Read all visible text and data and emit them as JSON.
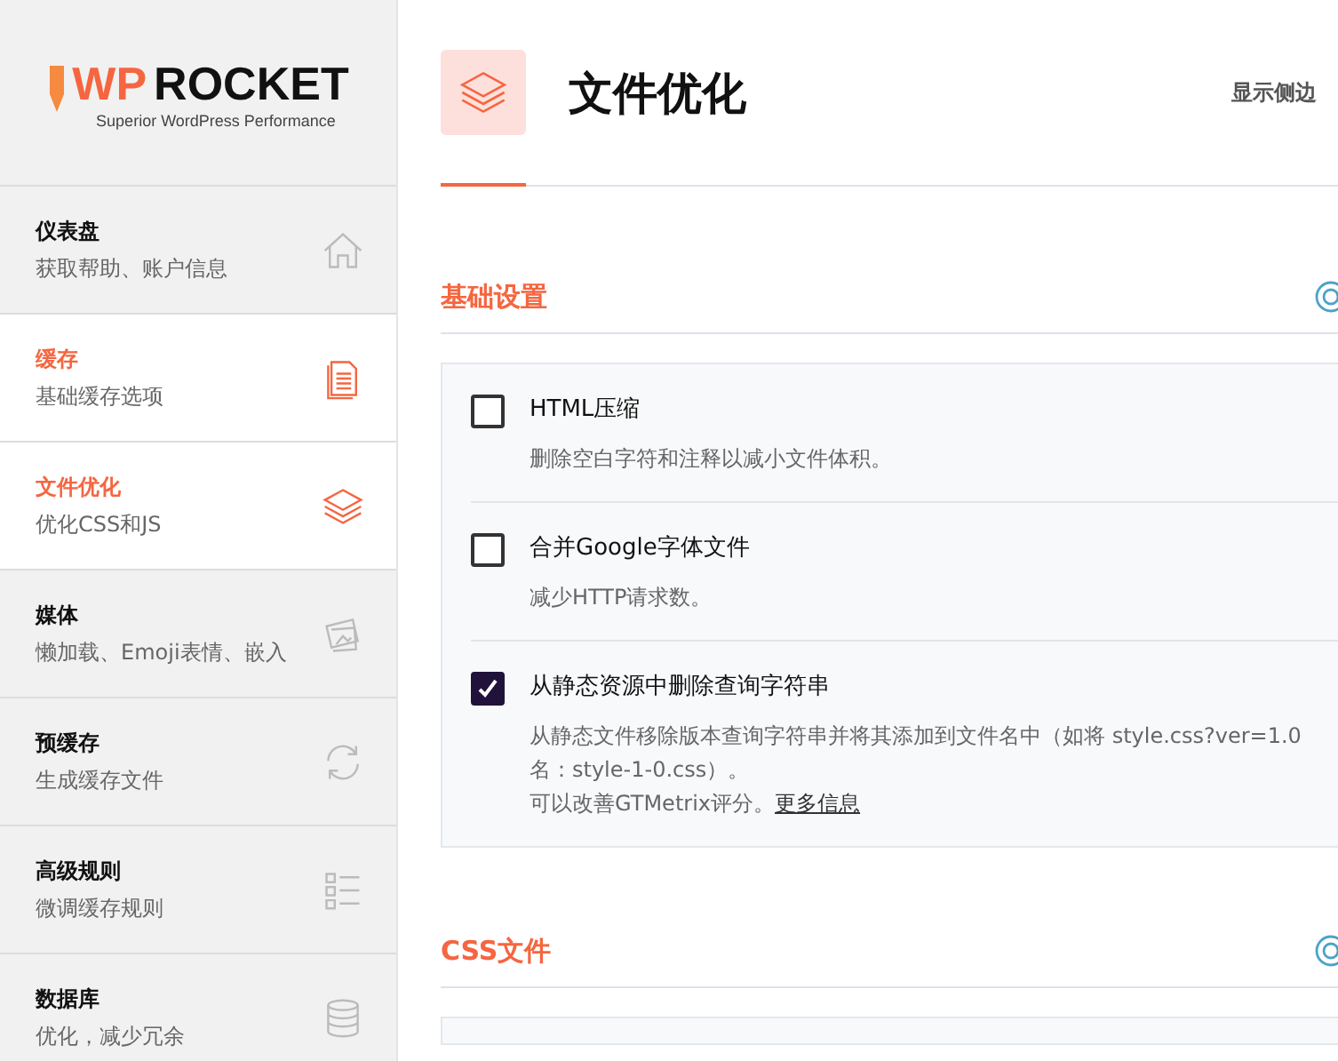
{
  "logo": {
    "name_wp": "WP",
    "name_rocket": "ROCKET",
    "tagline": "Superior WordPress Performance"
  },
  "sidebar": {
    "items": [
      {
        "title": "仪表盘",
        "subtitle": "获取帮助、账户信息",
        "highlighted": false
      },
      {
        "title": "缓存",
        "subtitle": "基础缓存选项",
        "highlighted": true
      },
      {
        "title": "文件优化",
        "subtitle": "优化CSS和JS",
        "highlighted": true
      },
      {
        "title": "媒体",
        "subtitle": "懒加载、Emoji表情、嵌入",
        "highlighted": false
      },
      {
        "title": "预缓存",
        "subtitle": "生成缓存文件",
        "highlighted": false
      },
      {
        "title": "高级规则",
        "subtitle": "微调缓存规则",
        "highlighted": false
      },
      {
        "title": "数据库",
        "subtitle": "优化，减少冗余",
        "highlighted": false
      }
    ]
  },
  "header": {
    "title": "文件优化",
    "sidebar_toggle": "显示侧边"
  },
  "sections": [
    {
      "title": "基础设置",
      "options": [
        {
          "label": "HTML压缩",
          "checked": false,
          "description": [
            "删除空白字符和注释以减小文件体积。"
          ]
        },
        {
          "label": "合并Google字体文件",
          "checked": false,
          "description": [
            "减少HTTP请求数。"
          ]
        },
        {
          "label": "从静态资源中删除查询字符串",
          "checked": true,
          "description": [
            "从静态文件移除版本查询字符串并将其添加到文件名中（如将 style.css?ver=1.0",
            "名：style-1-0.css）。",
            "可以改善GTMetrix评分。"
          ],
          "link": "更多信息"
        }
      ]
    },
    {
      "title": "CSS文件"
    }
  ]
}
